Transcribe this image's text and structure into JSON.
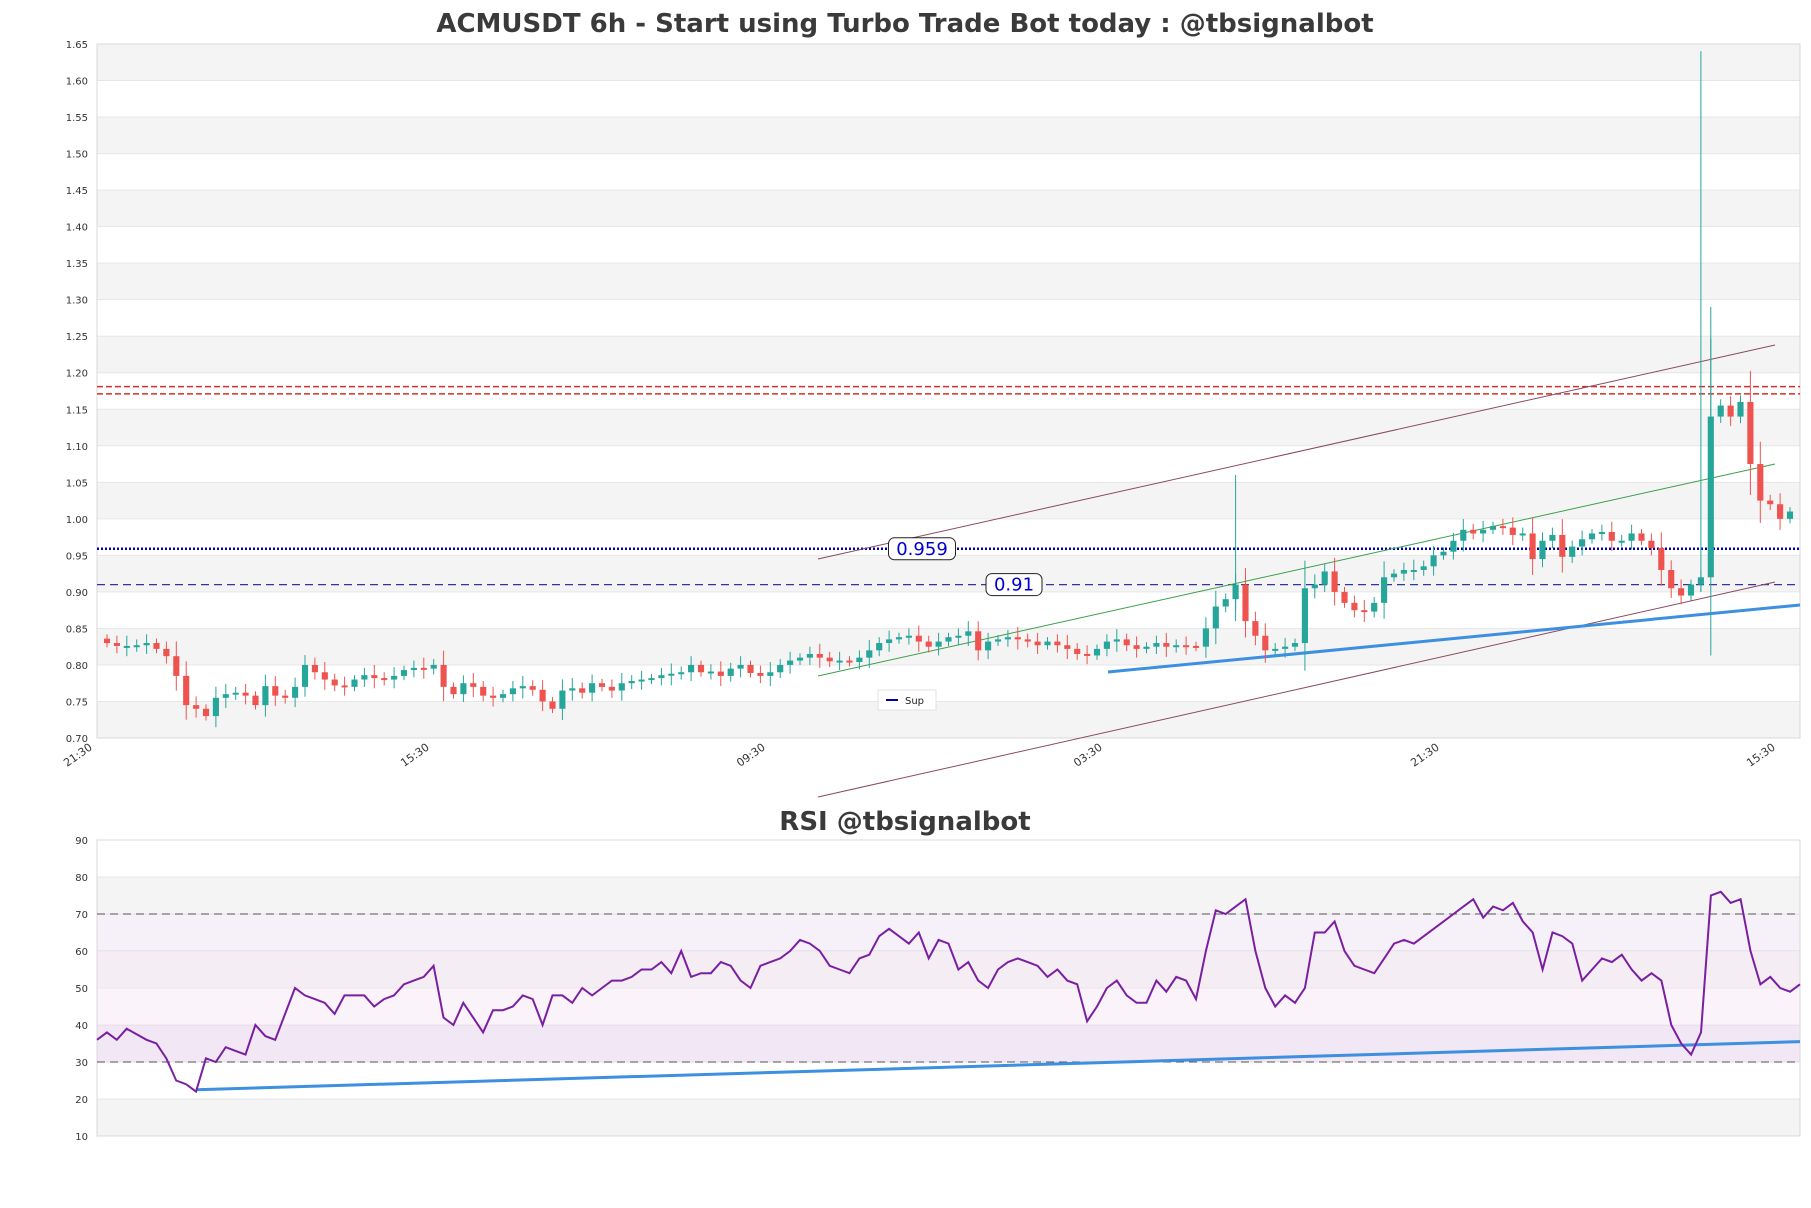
{
  "price_chart": {
    "title": "ACMUSDT 6h - Start using Turbo Trade Bot today : @tbsignalbot",
    "y_ticks": [
      "0.70",
      "0.75",
      "0.80",
      "0.85",
      "0.90",
      "0.95",
      "1.00",
      "1.05",
      "1.10",
      "1.15",
      "1.20",
      "1.25",
      "1.30",
      "1.35",
      "1.40",
      "1.45",
      "1.50",
      "1.55",
      "1.60",
      "1.65"
    ],
    "x_ticks": [
      "21:30",
      "15:30",
      "09:30",
      "03:30",
      "21:30",
      "15:30"
    ],
    "level_labels": [
      "0.959",
      "0.91"
    ],
    "legend_label": "Sup"
  },
  "rsi_chart": {
    "title": "RSI @tbsignalbot",
    "y_ticks": [
      "10",
      "20",
      "30",
      "40",
      "50",
      "60",
      "70",
      "80",
      "90"
    ]
  },
  "colors": {
    "bull": "#26a69a",
    "bear": "#ef5350",
    "support": "#0000aa",
    "resistance": "#d32f2f",
    "trend": "#3d8fe0",
    "channel": "#8b4a5e",
    "ma": "#3aa04a",
    "rsi": "#7b1fa2"
  },
  "chart_data": [
    {
      "type": "candlestick",
      "title": "ACMUSDT 6h - Start using Turbo Trade Bot today : @tbsignalbot",
      "ylim": [
        0.7,
        1.65
      ],
      "x_tick_labels": [
        "21:30",
        "15:30",
        "09:30",
        "03:30",
        "21:30",
        "15:30"
      ],
      "close": [
        0.83,
        0.826,
        0.826,
        0.827,
        0.83,
        0.822,
        0.812,
        0.785,
        0.745,
        0.74,
        0.73,
        0.755,
        0.76,
        0.762,
        0.758,
        0.745,
        0.771,
        0.758,
        0.755,
        0.77,
        0.8,
        0.79,
        0.78,
        0.772,
        0.77,
        0.78,
        0.786,
        0.782,
        0.78,
        0.785,
        0.793,
        0.796,
        0.795,
        0.8,
        0.77,
        0.76,
        0.775,
        0.77,
        0.758,
        0.755,
        0.76,
        0.768,
        0.771,
        0.766,
        0.75,
        0.74,
        0.765,
        0.768,
        0.762,
        0.775,
        0.77,
        0.765,
        0.775,
        0.778,
        0.78,
        0.782,
        0.786,
        0.788,
        0.79,
        0.8,
        0.79,
        0.791,
        0.785,
        0.795,
        0.8,
        0.789,
        0.785,
        0.79,
        0.8,
        0.806,
        0.81,
        0.815,
        0.81,
        0.805,
        0.806,
        0.804,
        0.81,
        0.82,
        0.83,
        0.835,
        0.838,
        0.84,
        0.832,
        0.825,
        0.832,
        0.838,
        0.84,
        0.846,
        0.82,
        0.832,
        0.835,
        0.838,
        0.835,
        0.832,
        0.827,
        0.832,
        0.827,
        0.822,
        0.815,
        0.813,
        0.822,
        0.832,
        0.835,
        0.827,
        0.822,
        0.825,
        0.83,
        0.825,
        0.827,
        0.826,
        0.825,
        0.85,
        0.88,
        0.89,
        0.91,
        0.86,
        0.84,
        0.82,
        0.822,
        0.825,
        0.83,
        0.905,
        0.91,
        0.928,
        0.9,
        0.885,
        0.875,
        0.873,
        0.885,
        0.92,
        0.925,
        0.93,
        0.93,
        0.935,
        0.95,
        0.955,
        0.97,
        0.985,
        0.98,
        0.985,
        0.99,
        0.988,
        0.978,
        0.98,
        0.945,
        0.97,
        0.978,
        0.948,
        0.962,
        0.972,
        0.98,
        0.982,
        0.97,
        0.97,
        0.98,
        0.97,
        0.96,
        0.93,
        0.905,
        0.895,
        0.91,
        0.92,
        1.14,
        1.155,
        1.14,
        1.16,
        1.075,
        1.025,
        1.02,
        1.0,
        1.01
      ]
    },
    {
      "type": "line",
      "title": "RSI @tbsignalbot",
      "ylim": [
        10,
        90
      ],
      "values": [
        36,
        38,
        36,
        39,
        37.5,
        36,
        35,
        31,
        25,
        24,
        22,
        31,
        30,
        34,
        33,
        32,
        40,
        37,
        36,
        43,
        50,
        48,
        47,
        46,
        43,
        48,
        48,
        48,
        45,
        47,
        48,
        51,
        52,
        53,
        56,
        42,
        40,
        46,
        42,
        38,
        44,
        44,
        45,
        48,
        47,
        40,
        48,
        48,
        46,
        50,
        48,
        50,
        52,
        52,
        53,
        55,
        55,
        57,
        54,
        60,
        53,
        54,
        54,
        57,
        56,
        52,
        50,
        56,
        57,
        58,
        60,
        63,
        62,
        60,
        56,
        55,
        54,
        58,
        59,
        64,
        66,
        64,
        62,
        65,
        58,
        63,
        62,
        55,
        57,
        52,
        50,
        55,
        57,
        58,
        57,
        56,
        53,
        55,
        52,
        51,
        41,
        45,
        50,
        52,
        48,
        46,
        46,
        52,
        49,
        53,
        52,
        47,
        60,
        71,
        70,
        72,
        74,
        60,
        50,
        45,
        48,
        46,
        50,
        65,
        65,
        68,
        60,
        56,
        55,
        54,
        58,
        62,
        63,
        62,
        64,
        66,
        68,
        70,
        72,
        74,
        69,
        72,
        71,
        73,
        68,
        65,
        55,
        65,
        64,
        62,
        52,
        55,
        58,
        57,
        59,
        55,
        52,
        54,
        52,
        40,
        35,
        32,
        38,
        75,
        76,
        73,
        74,
        60,
        51,
        53,
        50,
        49,
        51
      ]
    }
  ]
}
